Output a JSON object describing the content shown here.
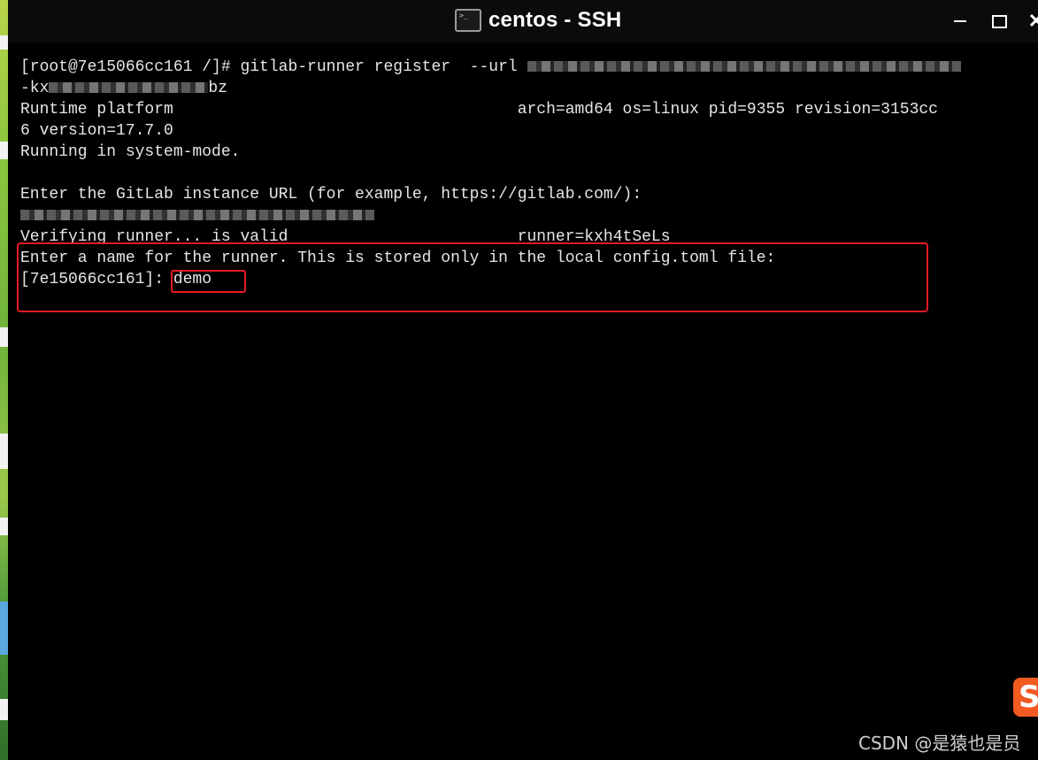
{
  "window": {
    "title": "centos - SSH",
    "close_glyph": "✕"
  },
  "terminal": {
    "lines": [
      {
        "a": "[root@7e15066cc161 /]# gitlab-runner register  --url ",
        "b": ""
      },
      {
        "a": "-kx",
        "b": "bz"
      },
      {
        "a": "Runtime platform                                    arch=amd64 os=linux pid=9355 revision=3153cc",
        "b": ""
      },
      {
        "a": "6 version=17.7.0",
        "b": ""
      },
      {
        "a": "Running in system-mode.",
        "b": ""
      },
      {
        "a": "",
        "b": ""
      },
      {
        "a": "Enter the GitLab instance URL (for example, https://gitlab.com/):",
        "b": ""
      },
      {
        "a": "",
        "b": ""
      },
      {
        "a": "Verifying runner... is valid                        runner=kxh4tSeLs",
        "b": ""
      },
      {
        "a": "Enter a name for the runner. This is stored only in the local config.toml file:",
        "b": ""
      },
      {
        "a": "[7e15066cc161]: demo",
        "b": ""
      }
    ]
  },
  "watermark": "CSDN @是猿也是员",
  "logo_glyph": "S",
  "colors": {
    "highlight": "#e51c23",
    "terminal_bg": "#000000",
    "terminal_fg": "#e6e6e6",
    "csdn_orange": "#f25a22"
  },
  "icons": [
    "terminal-app-icon",
    "minimize-icon",
    "maximize-icon",
    "close-icon",
    "csdn-logo-icon"
  ]
}
